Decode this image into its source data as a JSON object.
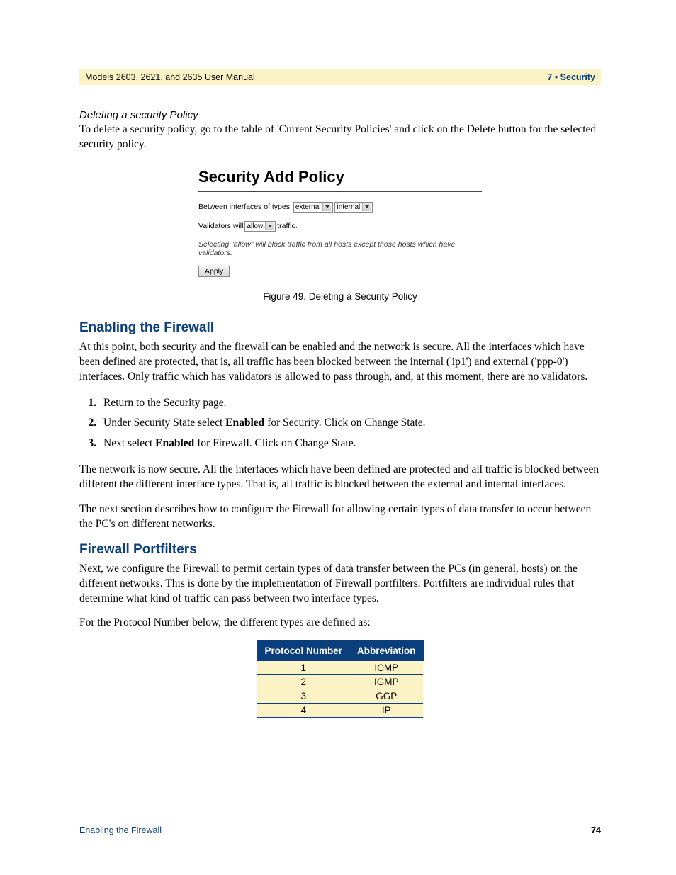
{
  "header": {
    "left": "Models 2603, 2621, and 2635 User Manual",
    "right": "7 • Security"
  },
  "sec_delete": {
    "title": "Deleting a security Policy",
    "body": "To delete a security policy, go to the table of 'Current Security Policies' and click on the Delete button for the selected security policy."
  },
  "figure": {
    "heading": "Security Add Policy",
    "row1_label": "Between interfaces of types:",
    "sel1": "external",
    "sel2": "internal",
    "row2_a": "Validators will",
    "sel3": "allow",
    "row2_b": "traffic.",
    "note": "Selecting \"allow\" will block traffic from all hosts except those hosts which have validators.",
    "apply": "Apply",
    "caption": "Figure 49. Deleting a Security Policy"
  },
  "sec_firewall": {
    "heading": "Enabling the Firewall",
    "p1": "At this point, both security and the firewall can be enabled and the network is secure. All the interfaces which have been defined are protected, that is, all traffic has been blocked between the internal ('ip1') and external ('ppp-0') interfaces. Only traffic which has validators is allowed to pass through, and, at this moment, there are no validators.",
    "li1": "Return to the Security page.",
    "li2a": "Under Security State select ",
    "li2b": "Enabled",
    "li2c": " for Security. Click on Change State.",
    "li3a": "Next select ",
    "li3b": "Enabled",
    "li3c": " for Firewall. Click on Change State.",
    "p2": "The network is now secure.  All the interfaces which have been defined are protected and all traffic is blocked between different the different interface types.   That is, all traffic is blocked between the external and internal interfaces.",
    "p3": "The next section describes how to configure the Firewall for allowing certain types of data transfer to occur between the PC's on different networks."
  },
  "sec_portfilters": {
    "heading": "Firewall Portfilters",
    "p1": "Next, we configure the Firewall to permit certain types of data transfer between the PCs (in general, hosts) on the different networks. This is done by the implementation of Firewall portfilters. Portfilters are individual rules that determine what kind of traffic can pass between two interface types.",
    "p2": "For the Protocol Number below, the different types are defined as:"
  },
  "chart_data": {
    "type": "table",
    "columns": [
      "Protocol Number",
      "Abbreviation"
    ],
    "rows": [
      {
        "num": "1",
        "abbr": "ICMP"
      },
      {
        "num": "2",
        "abbr": "IGMP"
      },
      {
        "num": "3",
        "abbr": "GGP"
      },
      {
        "num": "4",
        "abbr": "IP"
      }
    ]
  },
  "footer": {
    "left": "Enabling the Firewall",
    "right": "74"
  }
}
